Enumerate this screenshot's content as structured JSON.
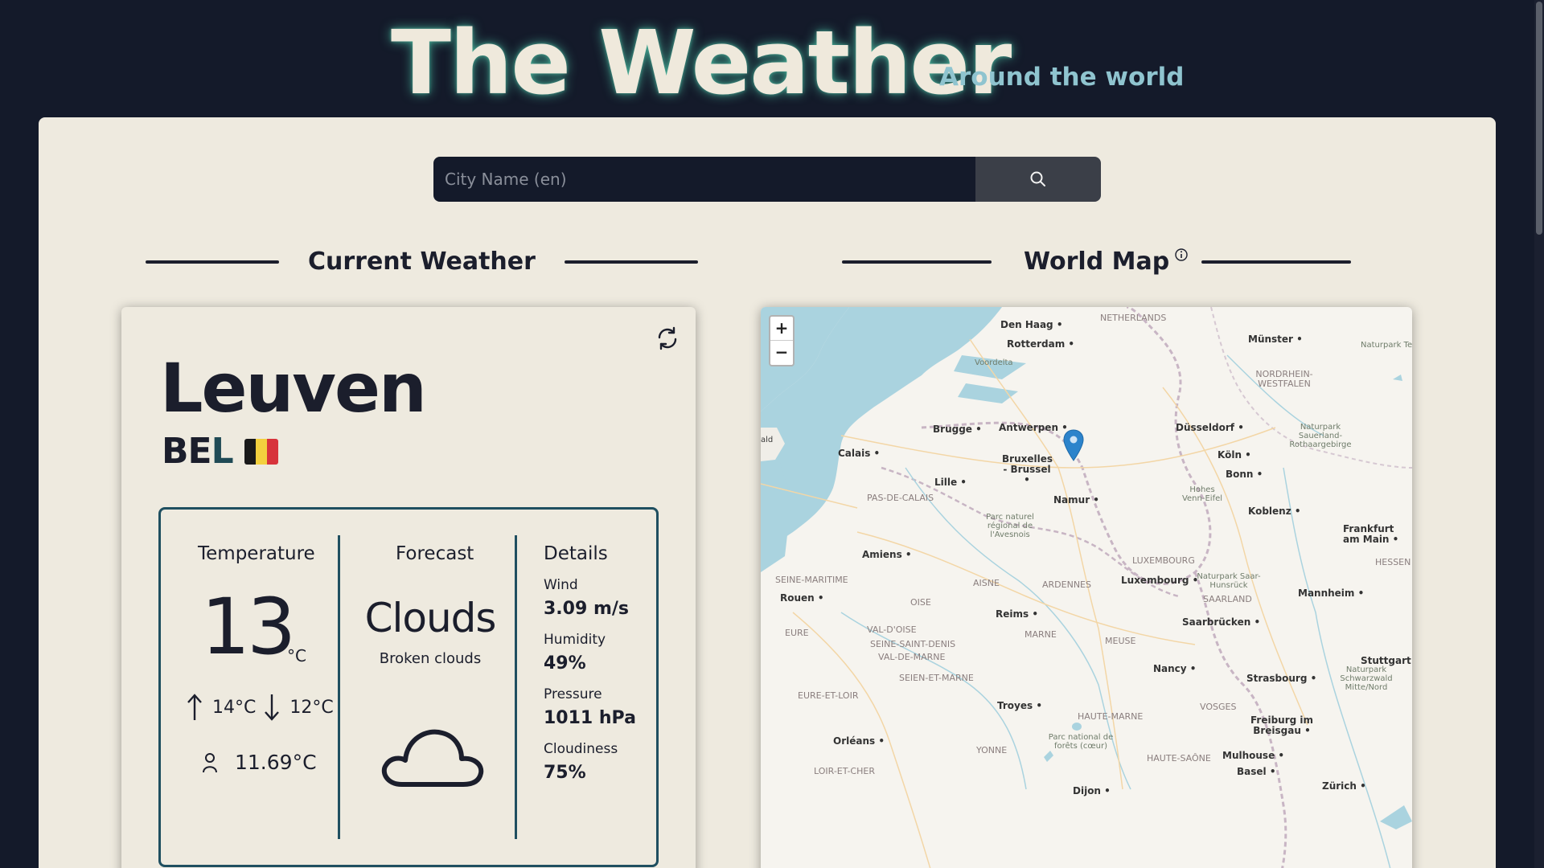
{
  "header": {
    "title": "The Weather",
    "subtitle": "Around the world"
  },
  "search": {
    "placeholder": "City Name (en)",
    "button_icon": "search-icon"
  },
  "sections": {
    "current_weather": "Current Weather",
    "world_map": "World Map",
    "world_map_icon": "info-icon"
  },
  "weather": {
    "city": "Leuven",
    "country_code_part1": "BE",
    "country_code_part2": "L",
    "flag_colors": [
      "#1a1a1a",
      "#f3d03e",
      "#d7333b"
    ],
    "refresh_icon": "refresh-icon",
    "temperature": {
      "heading": "Temperature",
      "value": "13",
      "unit": "°C",
      "max": "14°C",
      "min": "12°C",
      "feels_like": "11.69°C"
    },
    "forecast": {
      "heading": "Forecast",
      "main": "Clouds",
      "description": "Broken clouds",
      "icon": "cloud-icon"
    },
    "details": {
      "heading": "Details",
      "wind_label": "Wind",
      "wind_value": "3.09 m/s",
      "humidity_label": "Humidity",
      "humidity_value": "49%",
      "pressure_label": "Pressure",
      "pressure_value": "1011 hPa",
      "cloudiness_label": "Cloudiness",
      "cloudiness_value": "75%"
    }
  },
  "map": {
    "zoom_in": "+",
    "zoom_out": "−",
    "marker_icon": "location-pin-icon",
    "labels": {
      "den_haag": "Den Haag",
      "netherlands": "NETHERLANDS",
      "rotterdam": "Rotterdam",
      "voordelta": "Voordelta",
      "munster": "Münster",
      "naturpark_teuto": "Naturpark Teutoburger W Eggegebirg",
      "nordrhein": "NORDRHEIN-WESTFALEN",
      "brugge": "Brugge",
      "antwerpen": "Antwerpen",
      "dusseldorf": "Düsseldorf",
      "naturpark_sauerland": "Naturpark Sauerland-Rothaargebirge",
      "ald": "ald",
      "calais": "Calais",
      "bruxelles": "Bruxelles - Brussel",
      "koln": "Köln",
      "bonn": "Bonn",
      "lille": "Lille",
      "pas_de_calais": "PAS-DE-CALAIS",
      "namur": "Namur",
      "hohes_venn": "Hohes Venn-Eifel",
      "koblenz": "Koblenz",
      "parc_avesnois": "Parc naturel régional de l'Avesnois",
      "frankfurt": "Frankfurt am Main",
      "amiens": "Amiens",
      "luxembourg_region": "LUXEMBOURG",
      "hessen": "HESSEN",
      "seine_maritime": "SEINE-MARITIME",
      "aisne": "AISNE",
      "ardennes": "ARDENNES",
      "luxembourg": "Luxembourg",
      "naturpark_saar": "Naturpark Saar-Hunsrück",
      "rouen": "Rouen",
      "oise": "OISE",
      "mannheim": "Mannheim",
      "saarland": "SAARLAND",
      "reims": "Reims",
      "saarbrucken": "Saarbrücken",
      "eure": "EURE",
      "val_doise": "VAL-D'OISE",
      "marne": "MARNE",
      "seine_saint_denis": "SEINE-SAINT-DENIS",
      "meuse": "MEUSE",
      "val_de_marne": "VAL-DE-MARNE",
      "stuttgart": "Stuttgart",
      "nancy": "Nancy",
      "seien_et_marne": "SEIEN-ET-MARNE",
      "naturpark_schwarzwald": "Naturpark Schwarzwald Mitte/Nord",
      "strasbourg": "Strasbourg",
      "eure_et_loir": "EURE-ET-LOIR",
      "troyes": "Troyes",
      "vosges": "VOSGES",
      "haute_marne": "HAUTE-MARNE",
      "freiburg": "Freiburg im Breisgau",
      "orleans": "Orléans",
      "parc_forets": "Parc national de forêts (cœur)",
      "yonne": "YONNE",
      "mulhouse": "Mulhouse",
      "haute_saone": "HAUTE-SAÔNE",
      "loir_et_cher": "LOIR-ET-CHER",
      "basel": "Basel",
      "dijon": "Dijon",
      "zurich": "Zürich"
    }
  }
}
